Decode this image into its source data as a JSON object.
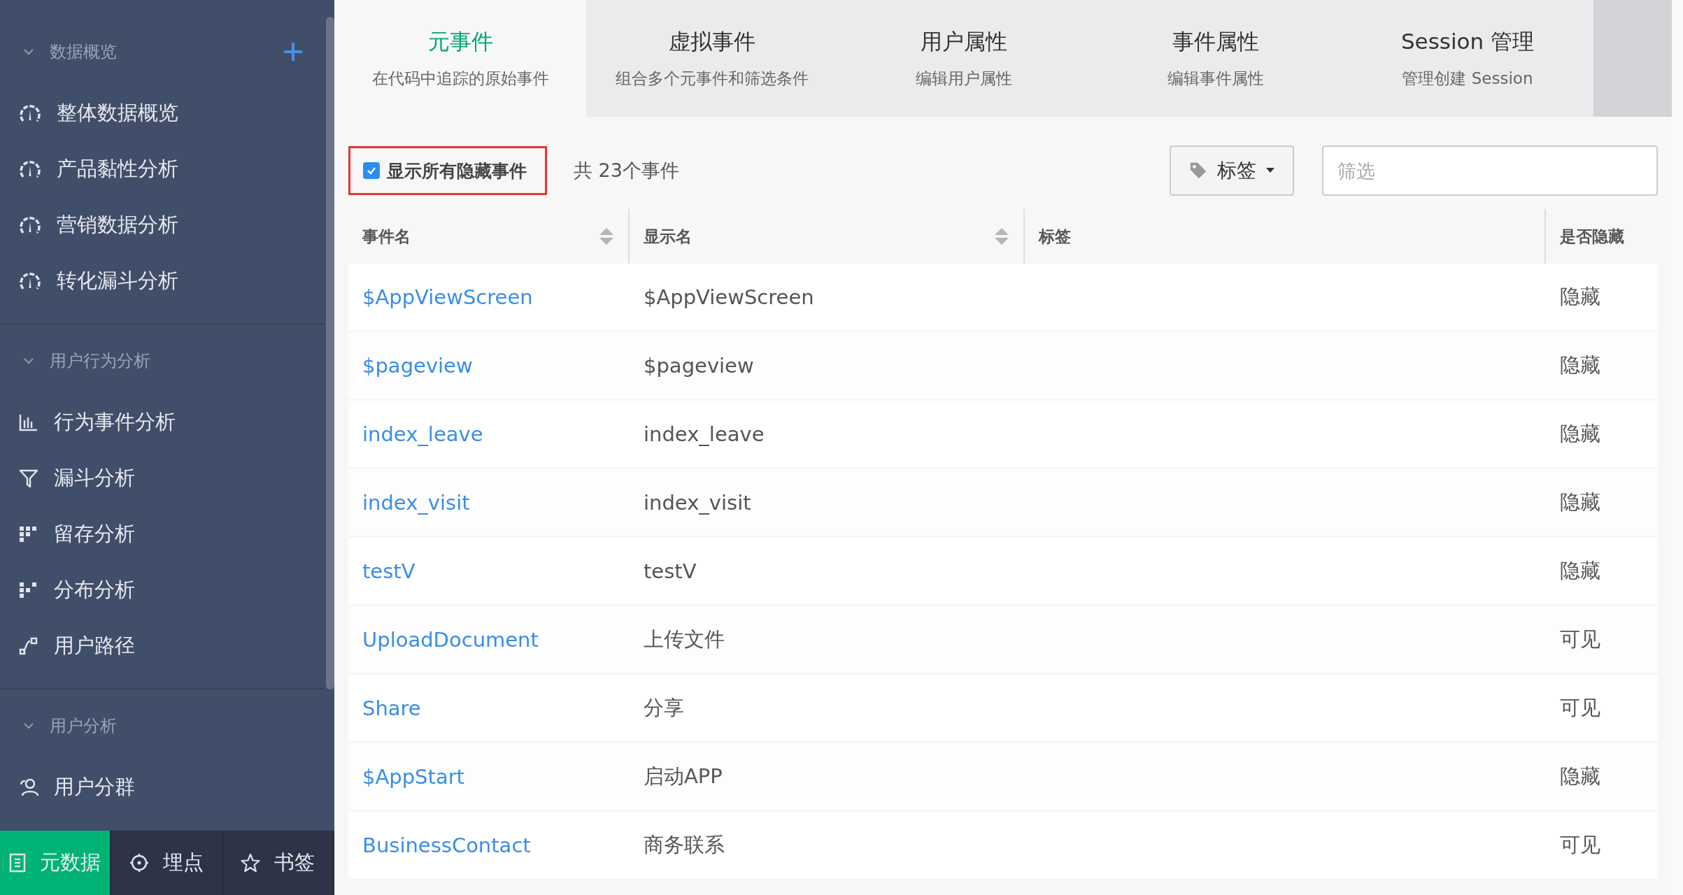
{
  "sidebar": {
    "groups": [
      {
        "title": "数据概览",
        "expanded": true,
        "items": [
          {
            "label": "整体数据概览"
          },
          {
            "label": "产品黏性分析"
          },
          {
            "label": "营销数据分析"
          },
          {
            "label": "转化漏斗分析"
          }
        ]
      },
      {
        "title": "用户行为分析",
        "expanded": true,
        "items": [
          {
            "label": "行为事件分析"
          },
          {
            "label": "漏斗分析"
          },
          {
            "label": "留存分析"
          },
          {
            "label": "分布分析"
          },
          {
            "label": "用户路径"
          }
        ]
      },
      {
        "title": "用户分析",
        "expanded": true,
        "items": [
          {
            "label": "用户分群"
          }
        ]
      }
    ]
  },
  "bottom_bar": [
    {
      "label": "元数据",
      "selected": true
    },
    {
      "label": "埋点",
      "selected": false
    },
    {
      "label": "书签",
      "selected": false
    }
  ],
  "tabs": [
    {
      "title": "元事件",
      "subtitle": "在代码中追踪的原始事件",
      "selected": true
    },
    {
      "title": "虚拟事件",
      "subtitle": "组合多个元事件和筛选条件",
      "selected": false
    },
    {
      "title": "用户属性",
      "subtitle": "编辑用户属性",
      "selected": false
    },
    {
      "title": "事件属性",
      "subtitle": "编辑事件属性",
      "selected": false
    },
    {
      "title": "Session 管理",
      "subtitle": "管理创建 Session",
      "selected": false
    }
  ],
  "toolbar": {
    "show_hidden": {
      "label": "显示所有隐藏事件",
      "checked": true,
      "highlighted": true
    },
    "count": "共 23个事件",
    "tag_button": "标签",
    "filter": {
      "placeholder": "筛选"
    }
  },
  "table": {
    "columns": [
      {
        "label": "事件名"
      },
      {
        "label": "显示名"
      },
      {
        "label": "标签"
      },
      {
        "label": "是否隐藏"
      }
    ],
    "rows": [
      {
        "event_name": "$AppViewScreen",
        "display_name": "$AppViewScreen",
        "visibility": "隐藏"
      },
      {
        "event_name": "$pageview",
        "display_name": "$pageview",
        "visibility": "隐藏"
      },
      {
        "event_name": "index_leave",
        "display_name": "index_leave",
        "visibility": "隐藏"
      },
      {
        "event_name": "index_visit",
        "display_name": "index_visit",
        "visibility": "隐藏"
      },
      {
        "event_name": "testV",
        "display_name": "testV",
        "visibility": "隐藏"
      },
      {
        "event_name": "UploadDocument",
        "display_name": "上传文件",
        "visibility": "可见"
      },
      {
        "event_name": "Share",
        "display_name": "分享",
        "visibility": "可见"
      },
      {
        "event_name": "$AppStart",
        "display_name": "启动APP",
        "visibility": "隐藏"
      },
      {
        "event_name": "BusinessContact",
        "display_name": "商务联系",
        "visibility": "可见"
      }
    ]
  }
}
